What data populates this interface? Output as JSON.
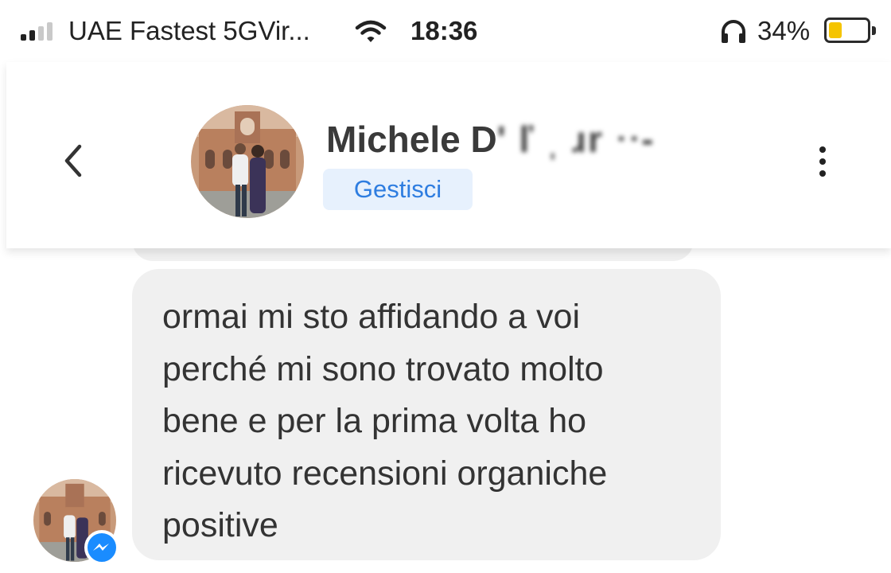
{
  "status_bar": {
    "carrier": "UAE Fastest 5GVir...",
    "time": "18:36",
    "battery_percent": "34%",
    "battery_level": 0.34,
    "signal_bars_active": 2,
    "icons": [
      "signal-icon",
      "wifi-icon",
      "headphones-icon",
      "battery-icon"
    ]
  },
  "header": {
    "contact_name_visible": "Michele D",
    "contact_name_obscured": "' ľ ˌ ɹr ᐧᐧ-",
    "manage_label": "Gestisci",
    "icons": [
      "back-chevron-icon",
      "more-vertical-icon"
    ]
  },
  "message": {
    "lines": [
      "ormai mi sto affidando a voi",
      "perché mi sono trovato molto",
      "bene e per la prima volta ho",
      "ricevuto recensioni organiche",
      "positive"
    ]
  },
  "colors": {
    "accent": "#2e7de0",
    "manage_bg": "#e7f1fd",
    "bubble_bg": "#f0f0f0",
    "battery_fill": "#f5c400",
    "messenger_badge": "#1a8cff"
  }
}
